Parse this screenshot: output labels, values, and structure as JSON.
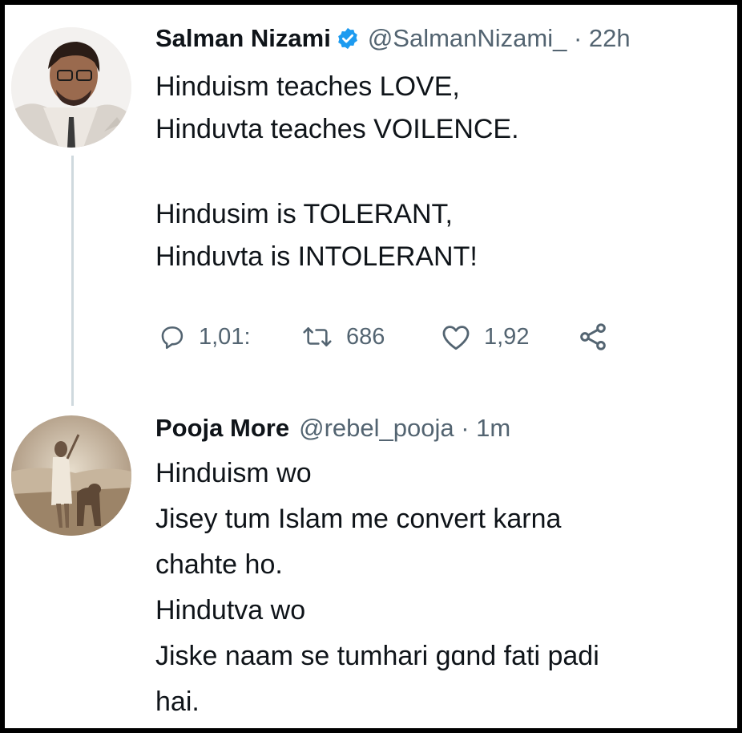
{
  "tweet1": {
    "name": "Salman Nizami",
    "handle": "@SalmanNizami_",
    "time": "· 22h",
    "verified_icon": "verified-badge-icon",
    "text": "Hinduism teaches LOVE,\nHinduvta teaches VOILENCE.\n\nHindusim is TOLERANT,\nHinduvta is INTOLERANT!",
    "actions": {
      "replies": "1,01:",
      "retweets": "686",
      "likes": "1,92",
      "reply_icon": "reply-icon",
      "retweet_icon": "retweet-icon",
      "like_icon": "heart-icon",
      "share_icon": "share-icon"
    }
  },
  "tweet2": {
    "name": "Pooja More",
    "handle": "@rebel_pooja",
    "time": "· 1m",
    "text": "Hinduism wo\nJisey tum Islam me convert karna\nchahte ho.\nHindutva wo\nJiske naam se tumhari gɑnd fati padi\nhai."
  },
  "colors": {
    "verified": "#1d9bf0",
    "secondary_text": "#536471",
    "primary_text": "#0f1419",
    "thread_line": "#cfd9de"
  }
}
